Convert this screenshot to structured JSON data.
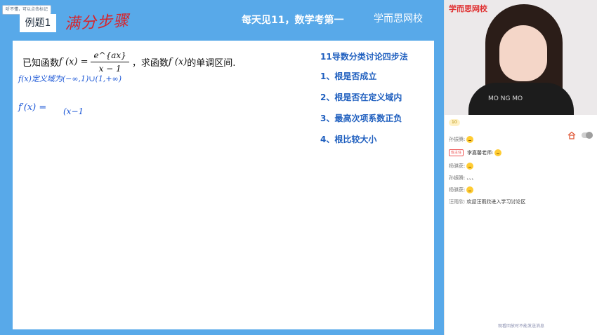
{
  "lesson": {
    "hint": "听不懂，可以点击标记",
    "example_label": "例题1",
    "handwritten_title": "满分步骤",
    "banner": "每天见11，数学考第一",
    "brand": "学而思网校",
    "question_prefix": "已知函数",
    "question_fx": "f (x) =",
    "question_num": "e^{ax}",
    "question_den": "x − 1",
    "question_suffix": "，求函数",
    "question_fx2": "f (x)",
    "question_tail": "的单调区间.",
    "hw_domain": "f(x)定义域为(−∞,1)∪(1,+∞)",
    "hw_deriv": "f′(x) =",
    "hw_expr": "(x−1",
    "method_title": "11导数分类讨论四步法",
    "methods": [
      "1、根是否成立",
      "2、根是否在定义域内",
      "3、最高次项系数正负",
      "4、根比较大小"
    ]
  },
  "side": {
    "video_brand": "学而思网校",
    "shirt_text": "MO  NG  MO",
    "stats": "10",
    "chat": [
      {
        "name": "孙振腾:",
        "role": "",
        "text": "",
        "emoji": true
      },
      {
        "name": "",
        "role": "班主任",
        "text": "李嘉馨老师:",
        "emoji": true
      },
      {
        "name": "杨骐获:",
        "role": "",
        "text": "",
        "emoji": true
      },
      {
        "name": "孙振腾:",
        "role": "",
        "text": "、、、",
        "emoji": false
      },
      {
        "name": "杨骐获:",
        "role": "",
        "text": "",
        "emoji": true
      },
      {
        "name": "汪雨欣:",
        "role": "",
        "text": "欢迎汪雨欣进入学习讨论区",
        "emoji": false
      }
    ],
    "footer": "观看回放时不能发送消息"
  }
}
